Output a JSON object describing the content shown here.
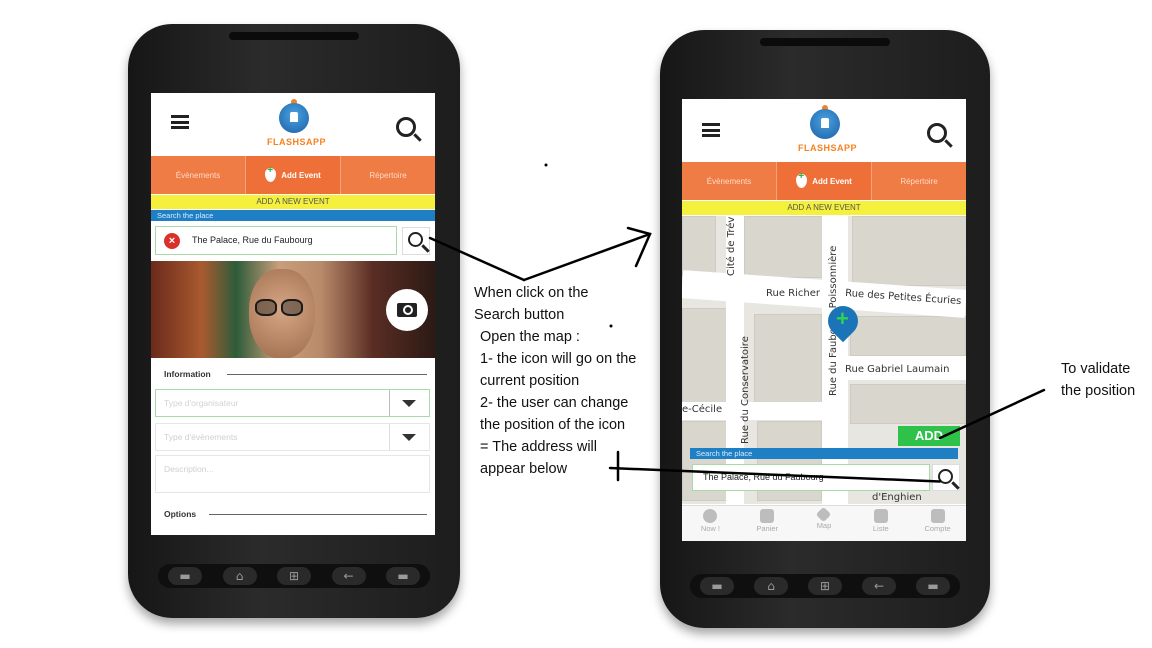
{
  "app": {
    "logo_text": "FLASHSAPP",
    "tabs": [
      "Évènements",
      "Add Event",
      "Répertoire"
    ],
    "banner": "ADD A NEW EVENT",
    "search_label": "Search the place",
    "address": "The Palace, Rue du Faubourg"
  },
  "form": {
    "section_information": "Information",
    "organizer_placeholder": "Type d'organisateur",
    "event_type_placeholder": "Type d'évènements",
    "description_placeholder": "Description...",
    "section_options": "Options"
  },
  "map": {
    "streets": [
      "Rue Richer",
      "Rue des Petites Écuries",
      "Rue Gabriel Laumain",
      "Cité de Trévise",
      "Rue du Faubourg Poissonnière",
      "Rue du Conservatoire",
      "e-Cécile",
      "d'Enghien"
    ],
    "add_button": "ADD"
  },
  "bottom_nav": [
    "Now !",
    "Panier",
    "Map",
    "Liste",
    "Compte"
  ],
  "hardware_keys": [
    "⌂",
    "⊞",
    "←"
  ],
  "annotations": {
    "search_note": [
      "When click on the",
      "Search button",
      "Open the map :",
      "1- the icon will go on the",
      "current position",
      "2- the user can change",
      "the position of the icon",
      "= The address will",
      "appear below"
    ],
    "validate_note": [
      "To validate",
      "the position"
    ]
  },
  "colors": {
    "tab_orange": "#f07c45",
    "banner_yellow": "#f4f03c",
    "search_blue": "#1f7fc4",
    "add_green": "#2fc24a",
    "marker_blue": "#1b74b8"
  }
}
